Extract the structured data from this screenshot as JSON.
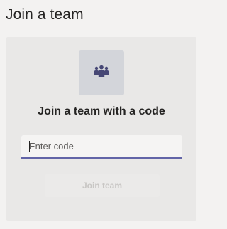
{
  "page": {
    "title": "Join a team"
  },
  "card": {
    "icon": "team-people-icon",
    "heading": "Join a team with a code",
    "code_input": {
      "value": "",
      "placeholder": "Enter code"
    },
    "join_button_label": "Join team",
    "join_button_enabled": false
  },
  "colors": {
    "accent": "#6264a7",
    "background": "#f3f2f1",
    "card": "#e9e8e7",
    "icon_tile": "#d3d5da",
    "icon_glyph": "#464775",
    "disabled_text": "#c8c6c4"
  }
}
